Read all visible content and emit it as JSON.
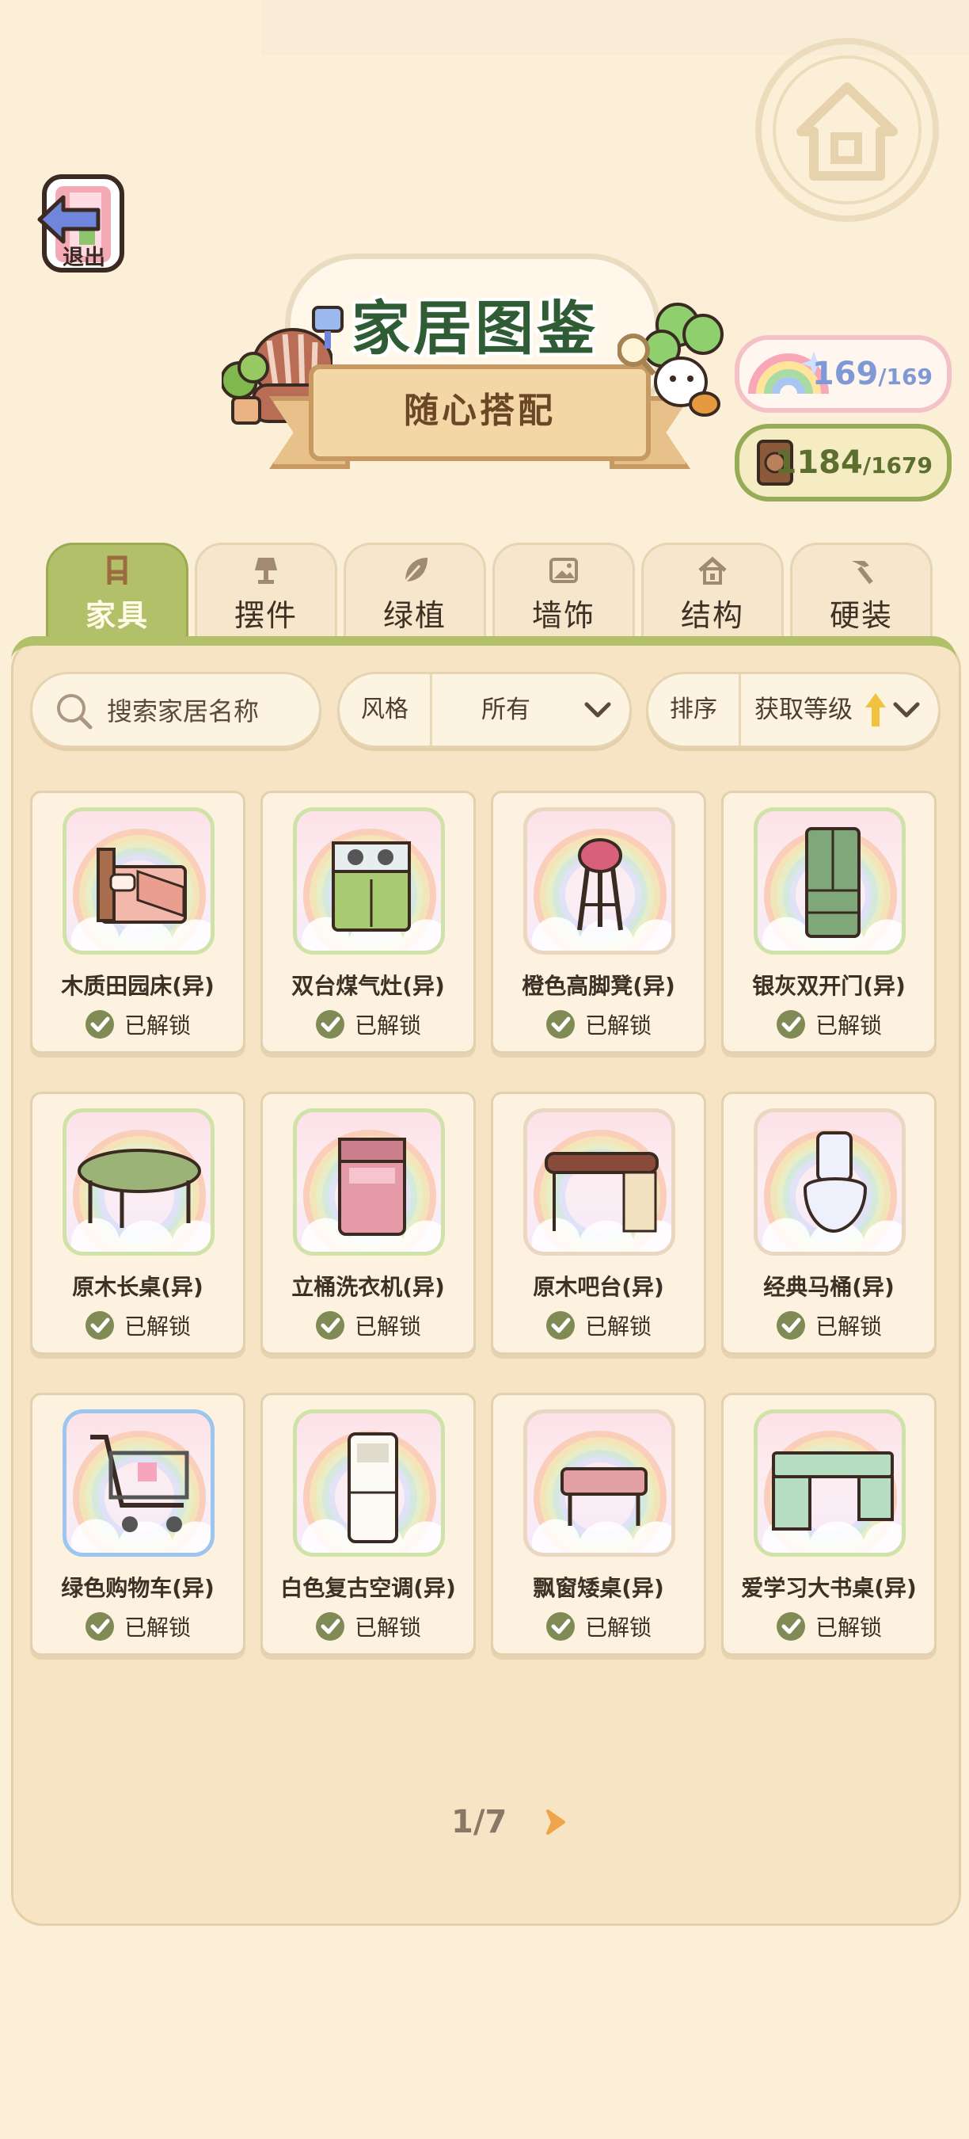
{
  "header": {
    "exit_label": "退出",
    "title": "家居图鉴",
    "subtitle": "随心搭配"
  },
  "counters": {
    "star": {
      "current": "169",
      "total": "/169"
    },
    "book": {
      "current": "1184",
      "total": "/1679"
    }
  },
  "tabs": [
    {
      "label": "家具",
      "icon": "chair-icon",
      "active": true
    },
    {
      "label": "摆件",
      "icon": "lamp-icon"
    },
    {
      "label": "绿植",
      "icon": "leaf-icon"
    },
    {
      "label": "墙饰",
      "icon": "picture-icon"
    },
    {
      "label": "结构",
      "icon": "house-icon"
    },
    {
      "label": "硬装",
      "icon": "hammer-icon"
    }
  ],
  "filters": {
    "search_placeholder": "搜索家居名称",
    "style_label": "风格",
    "style_value": "所有",
    "sort_label": "排序",
    "sort_value": "获取等级"
  },
  "items": [
    {
      "name": "木质田园床(异)",
      "status": "已解锁",
      "icon": "bed-icon"
    },
    {
      "name": "双台煤气灶(异)",
      "status": "已解锁",
      "icon": "stove-icon"
    },
    {
      "name": "橙色高脚凳(异)",
      "status": "已解锁",
      "icon": "bar-stool-icon"
    },
    {
      "name": "银灰双开门(异)",
      "status": "已解锁",
      "icon": "fridge-icon"
    },
    {
      "name": "原木长桌(异)",
      "status": "已解锁",
      "icon": "long-table-icon"
    },
    {
      "name": "立桶洗衣机(异)",
      "status": "已解锁",
      "icon": "washing-machine-icon"
    },
    {
      "name": "原木吧台(异)",
      "status": "已解锁",
      "icon": "bar-counter-icon"
    },
    {
      "name": "经典马桶(异)",
      "status": "已解锁",
      "icon": "toilet-icon"
    },
    {
      "name": "绿色购物车(异)",
      "status": "已解锁",
      "icon": "shopping-cart-icon"
    },
    {
      "name": "白色复古空调(异)",
      "status": "已解锁",
      "icon": "air-conditioner-icon"
    },
    {
      "name": "飘窗矮桌(异)",
      "status": "已解锁",
      "icon": "low-table-icon"
    },
    {
      "name": "爱学习大书桌(异)",
      "status": "已解锁",
      "icon": "desk-icon"
    }
  ],
  "pager": {
    "text": "1/7"
  }
}
